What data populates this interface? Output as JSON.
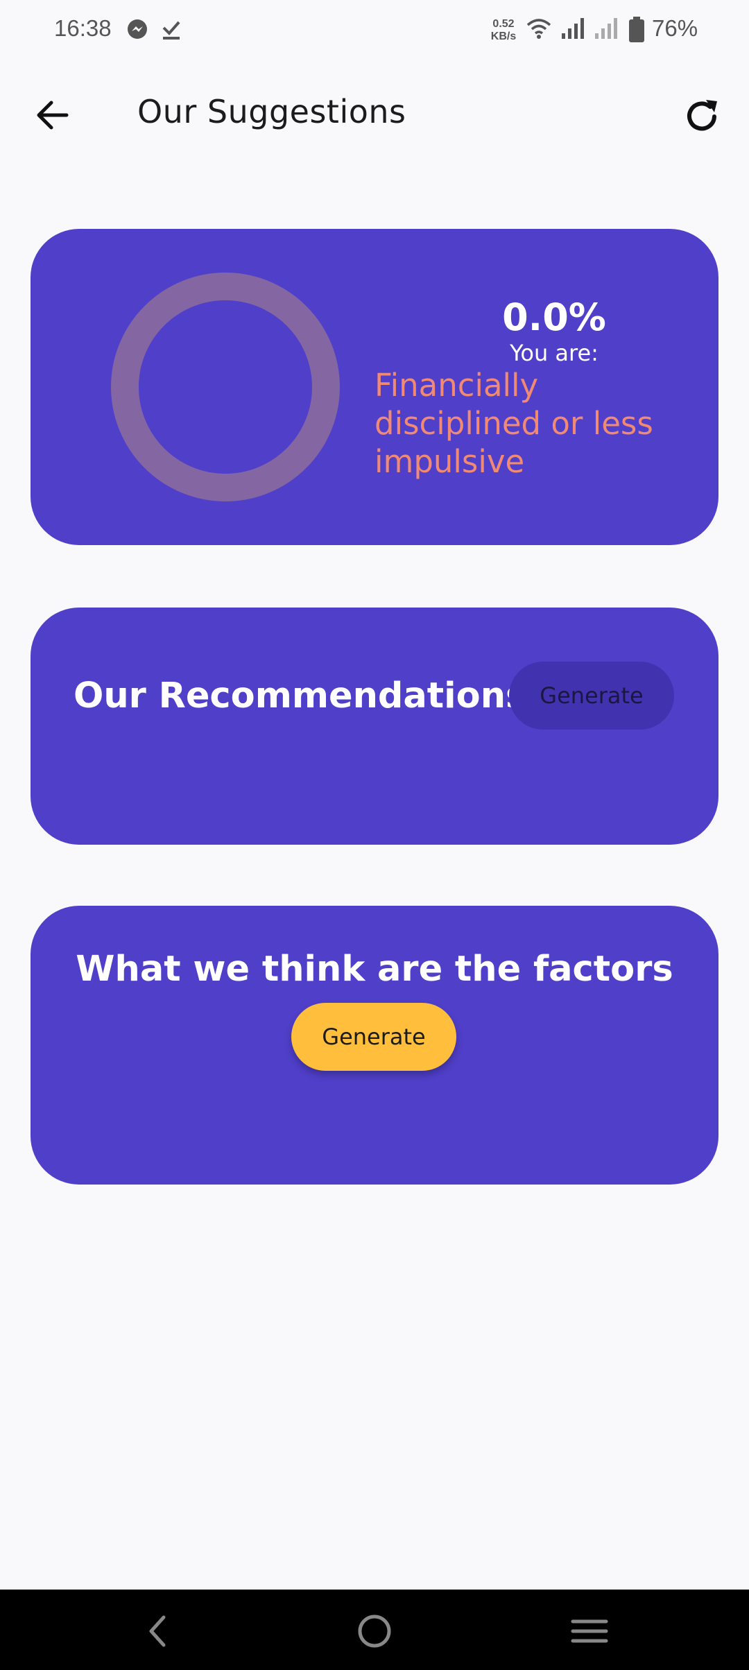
{
  "status_bar": {
    "time": "16:38",
    "left_icons": [
      "messenger-icon",
      "download-check-icon"
    ],
    "net_speed_value": "0.52",
    "net_speed_unit": "KB/s",
    "right_icons": [
      "wifi-icon",
      "signal-sim1-icon",
      "signal-sim2-icon",
      "battery-icon"
    ],
    "battery": "76%"
  },
  "app_bar": {
    "title": "Our Suggestions",
    "back_icon": "arrow-back-icon",
    "refresh_icon": "refresh-icon"
  },
  "score_card": {
    "percentage": "0.0%",
    "progress": 0.0,
    "you_are_label": "You are:",
    "verdict": "Financially disciplined or less impulsive"
  },
  "recommendations_card": {
    "title": "Our Recommendations",
    "button_label": "Generate"
  },
  "factors_card": {
    "title": "What we think are the factors",
    "button_label": "Generate"
  },
  "nav_bar": {
    "icons": [
      "nav-back-icon",
      "nav-home-icon",
      "nav-menu-icon"
    ]
  },
  "colors": {
    "card": "#4f3fc9",
    "ring_track": "#8466a3",
    "verdict_text": "#f08a74",
    "accent_button": "#ffbe3b",
    "muted_button": "#4133b0",
    "background": "#f9f9fc"
  }
}
